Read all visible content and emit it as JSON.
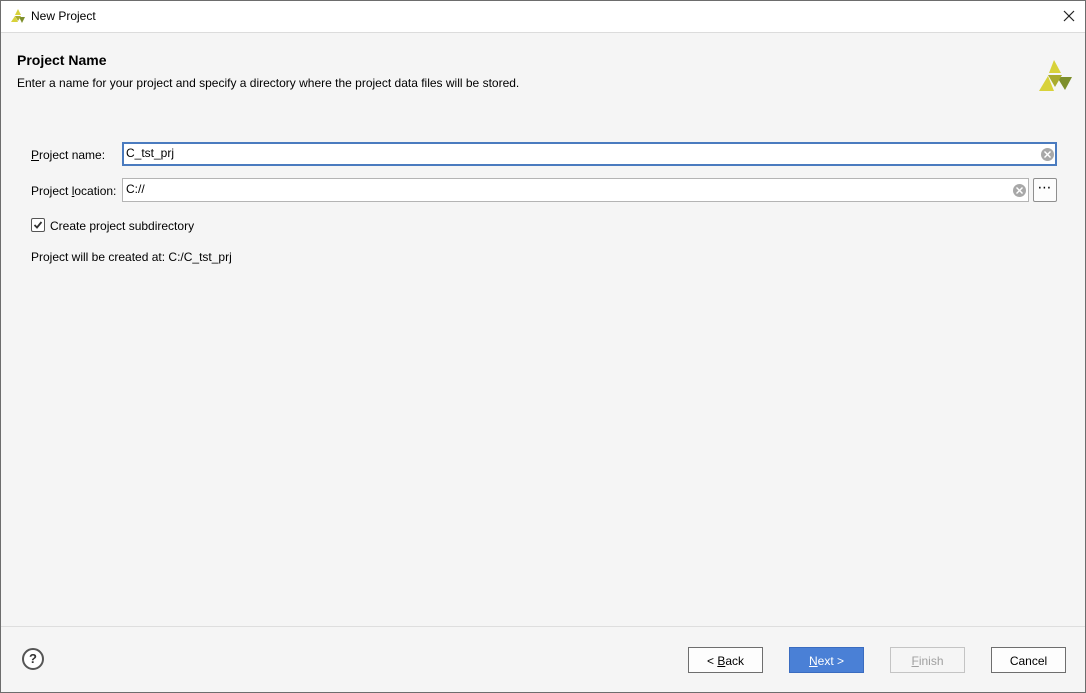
{
  "window": {
    "title": "New Project"
  },
  "header": {
    "title": "Project Name",
    "subtitle": "Enter a name for your project and specify a directory where the project data files will be stored."
  },
  "form": {
    "project_name": {
      "label_mnemonic": "P",
      "label_rest": "roject name:",
      "value": "C_tst_prj"
    },
    "project_location": {
      "label_before": "Project ",
      "label_mnemonic": "l",
      "label_after": "ocation:",
      "value": "C://",
      "browse_label": "⋯"
    },
    "create_subdirectory": {
      "label": "Create project subdirectory",
      "checked": true
    },
    "created_at": "Project will be created at: C:/C_tst_prj"
  },
  "footer": {
    "help_label": "?",
    "back": {
      "prefix": "< ",
      "mnemonic": "B",
      "rest": "ack"
    },
    "next": {
      "mnemonic": "N",
      "rest": "ext >"
    },
    "finish": {
      "mnemonic": "F",
      "rest": "inish"
    },
    "cancel": "Cancel"
  },
  "colors": {
    "accent": "#4a80d6",
    "logo_yellow": "#d8d23a",
    "logo_green": "#7d8f2c"
  }
}
